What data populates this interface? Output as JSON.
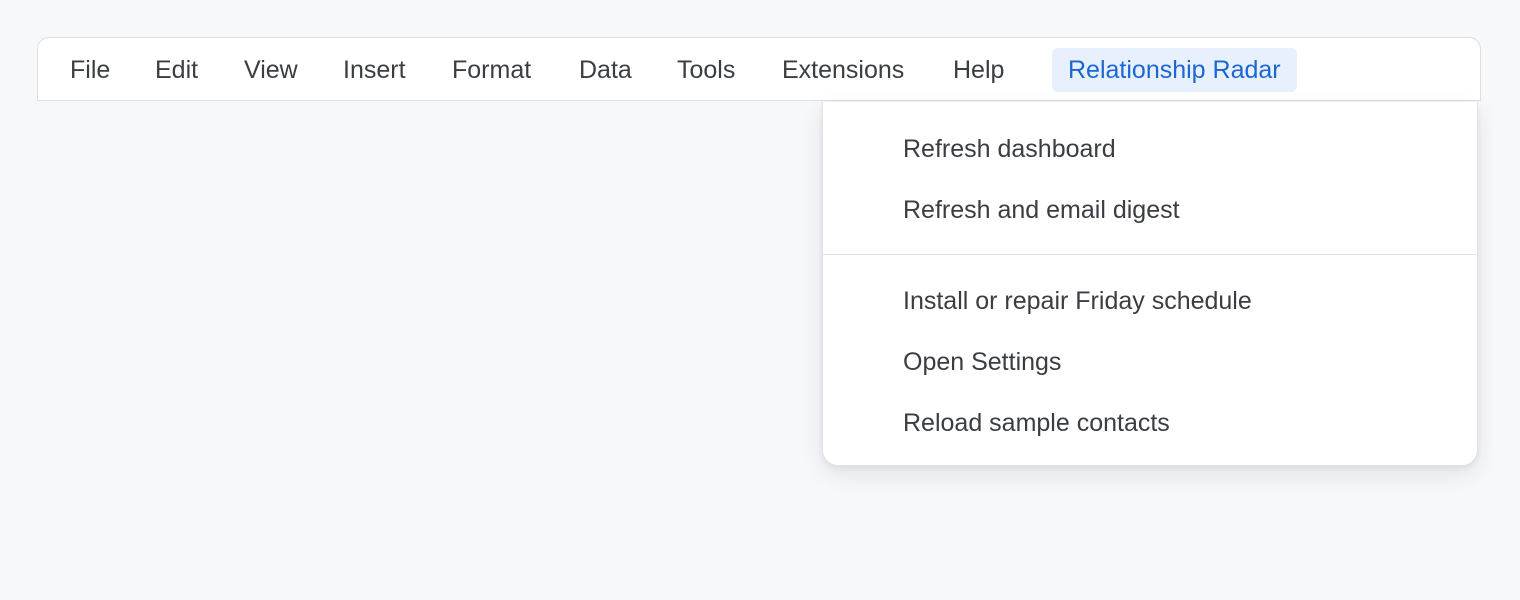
{
  "menubar": {
    "items": [
      {
        "label": "File"
      },
      {
        "label": "Edit"
      },
      {
        "label": "View"
      },
      {
        "label": "Insert"
      },
      {
        "label": "Format"
      },
      {
        "label": "Data"
      },
      {
        "label": "Tools"
      },
      {
        "label": "Extensions"
      },
      {
        "label": "Help"
      },
      {
        "label": "Relationship Radar",
        "active": true
      }
    ]
  },
  "dropdown": {
    "group1": [
      {
        "label": "Refresh dashboard"
      },
      {
        "label": "Refresh and email digest"
      }
    ],
    "group2": [
      {
        "label": "Install or repair Friday schedule"
      },
      {
        "label": "Open Settings"
      },
      {
        "label": "Reload sample contacts"
      }
    ]
  },
  "colors": {
    "background": "#f7f8fa",
    "active_menu_bg": "#e8f0fe",
    "active_menu_text": "#1a66d2",
    "text": "#3a3d42"
  }
}
